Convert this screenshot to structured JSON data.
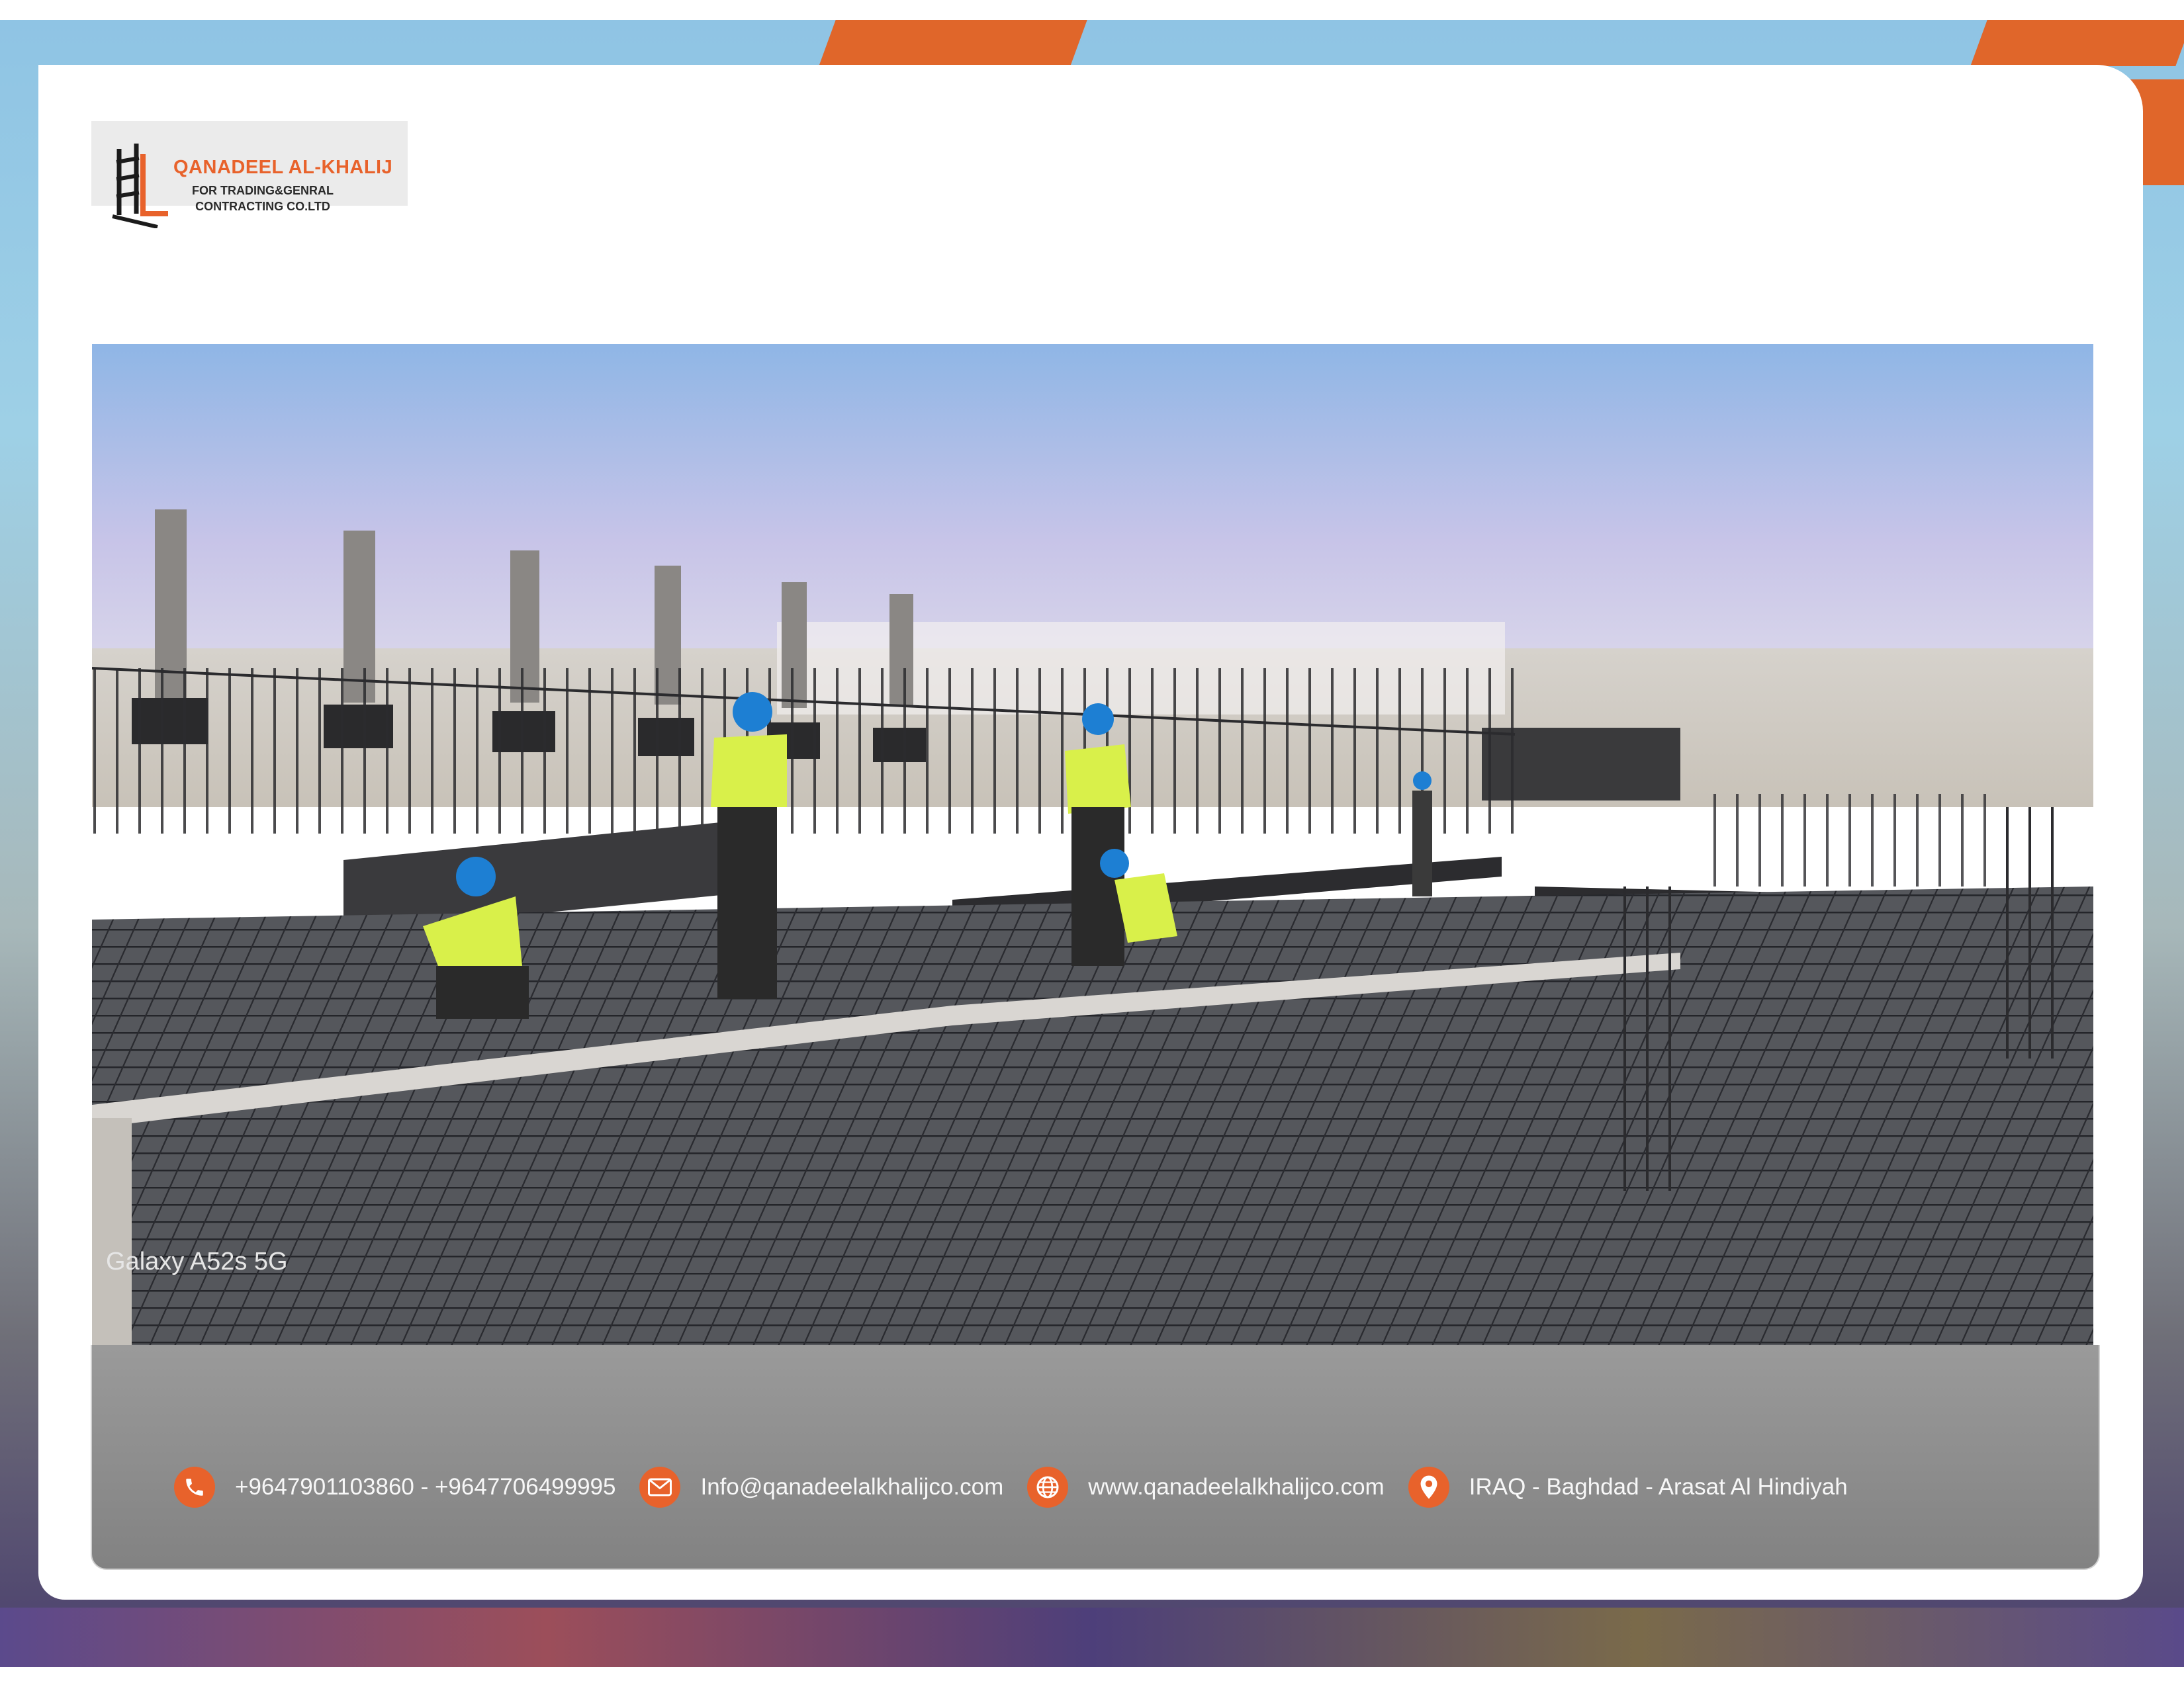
{
  "logo": {
    "title": "QANADEEL AL-KHALIJ",
    "subtitle_line1": "FOR TRADING&GENRAL",
    "subtitle_line2": "CONTRACTING CO.LTD"
  },
  "photo": {
    "watermark": "Galaxy A52s 5G"
  },
  "contact": {
    "phone": "+9647901103860 - +9647706499995",
    "email": "Info@qanadeelalkhalijco.com",
    "website": "www.qanadeelalkhalijco.com",
    "address": "IRAQ - Baghdad - Arasat Al Hindiyah"
  },
  "icons": {
    "phone": "phone-icon",
    "email": "email-icon",
    "website": "globe-icon",
    "address": "location-pin-icon",
    "logo": "scaffold-logo-icon"
  },
  "colors": {
    "accent": "#e8622b",
    "contact_bar": "#8d8d8d"
  }
}
